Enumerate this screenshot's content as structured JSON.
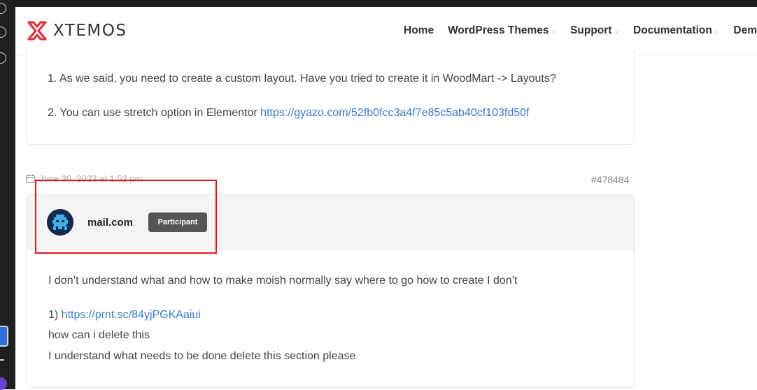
{
  "header": {
    "logo_text": "XTEMOS",
    "nav": [
      {
        "label": "Home",
        "has_caret": false
      },
      {
        "label": "WordPress Themes",
        "has_caret": true
      },
      {
        "label": "Support",
        "has_caret": true
      },
      {
        "label": "Documentation",
        "has_caret": true
      },
      {
        "label": "Demo",
        "has_caret": false
      }
    ],
    "caret": "⌄"
  },
  "previous_reply": {
    "line1": "1. As we said, you need to create a custom layout. Have you tried to create it in WoodMart -> Layouts?",
    "line2_prefix": "2. You can use stretch option in Elementor ",
    "line2_link": "https://gyazo.com/52fb0fcc3a4f7e85c5ab40cf103fd50f"
  },
  "reply": {
    "date": "June 30, 2023 at 1:52 pm",
    "id": "#478484",
    "author": "mail.com",
    "role": "Participant",
    "body_line1": "I don’t understand what and how to make moish normally say where to go how to create I don’t",
    "body_line2_prefix": "1) ",
    "body_line2_link": "https://prnt.sc/84yjPGKAaiui",
    "body_line3": "how can i delete this",
    "body_line4": "I understand what needs to be done delete this section please"
  },
  "colors": {
    "link": "#3a7bc8",
    "highlight": "#e0161c",
    "badge": "#555555",
    "logo_red": "#d9363e"
  }
}
